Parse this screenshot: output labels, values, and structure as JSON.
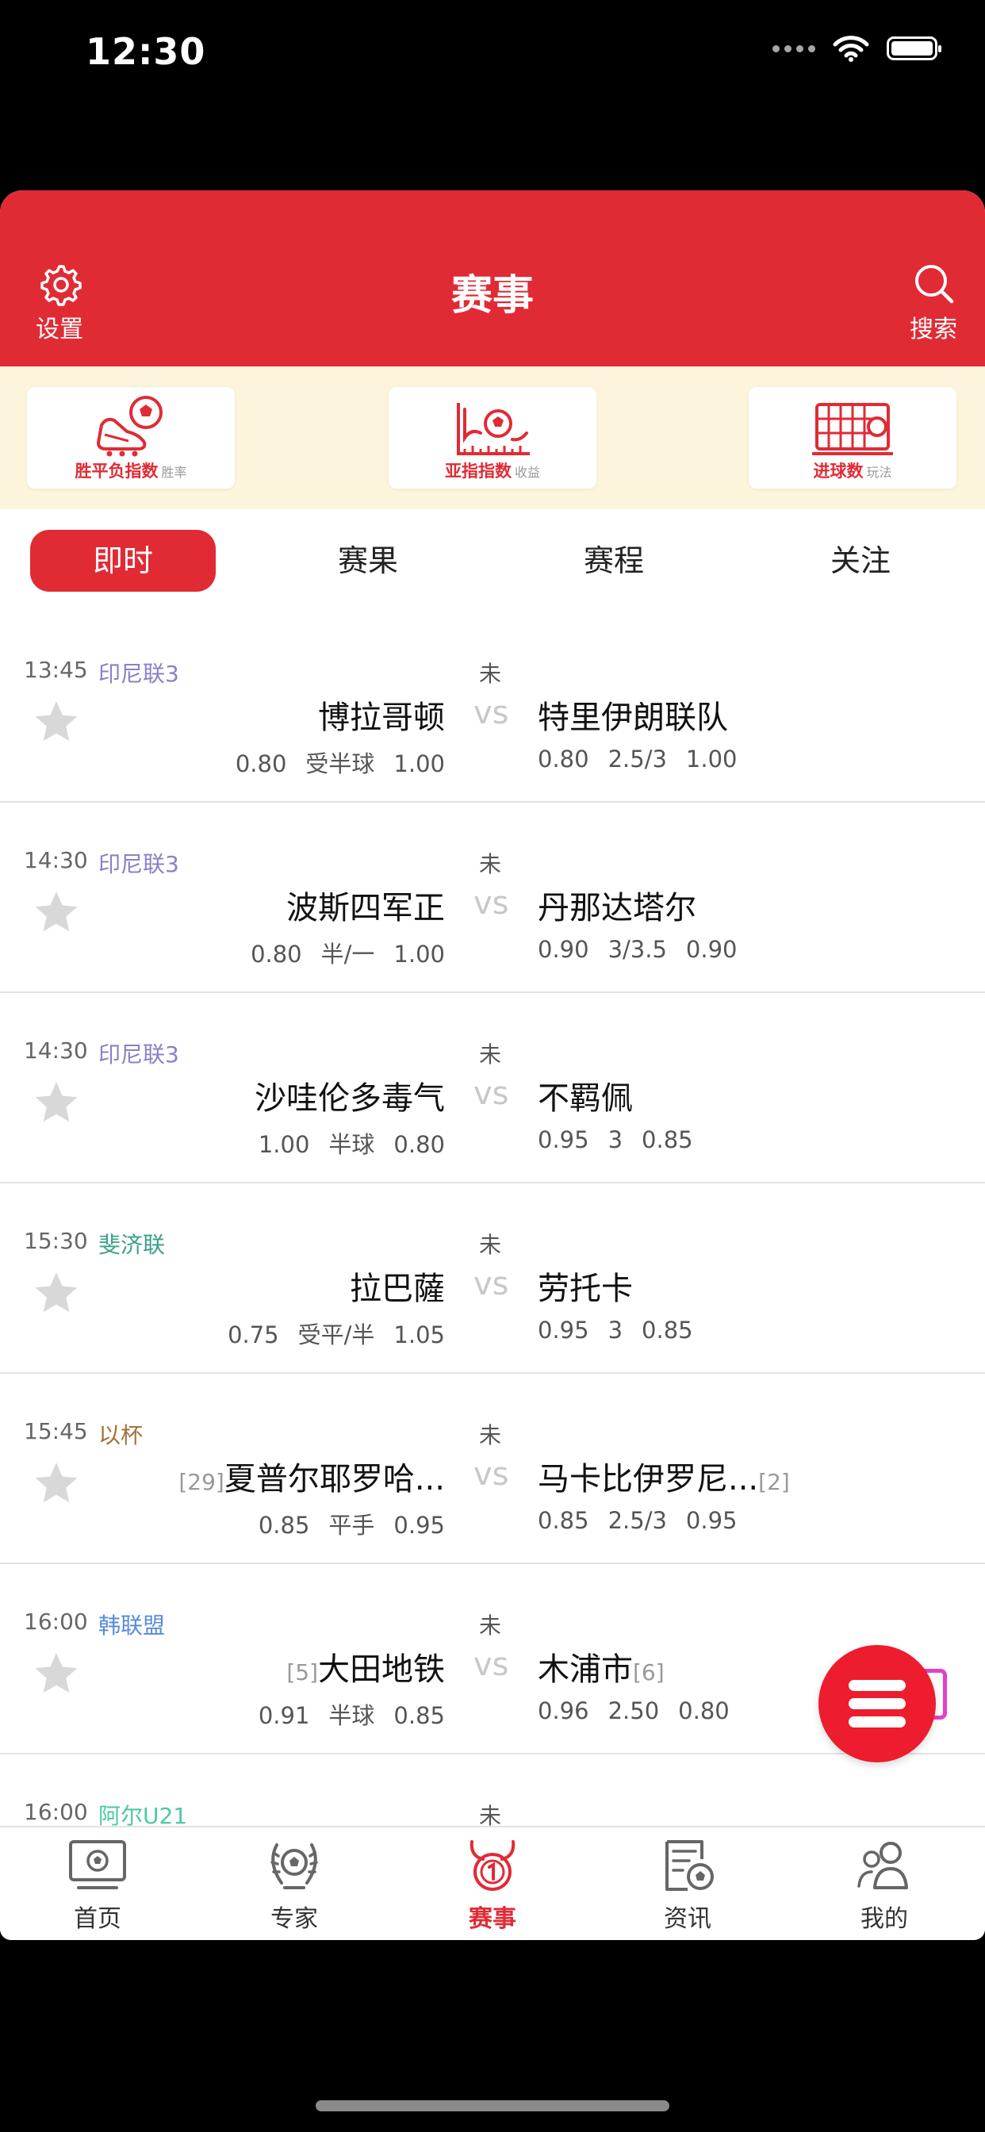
{
  "status_bar": {
    "time": "12:30"
  },
  "header": {
    "title": "赛事",
    "left_label": "设置",
    "right_label": "搜索"
  },
  "promo": [
    {
      "label": "胜平负指数",
      "sub": "胜率"
    },
    {
      "label": "亚指指数",
      "sub": "收益"
    },
    {
      "label": "进球数",
      "sub": "玩法"
    }
  ],
  "tabs": [
    {
      "label": "即时",
      "active": true
    },
    {
      "label": "赛果"
    },
    {
      "label": "赛程"
    },
    {
      "label": "关注"
    }
  ],
  "vs_label": "vs",
  "matches": [
    {
      "time": "13:45",
      "league": "印尼联3",
      "league_color": "#8a80c8",
      "status": "未",
      "home": "博拉哥顿",
      "home_rank": "",
      "away": "特里伊朗联队",
      "away_rank": "",
      "home_odds": [
        "0.80",
        "受半球",
        "1.00"
      ],
      "away_odds": [
        "0.80",
        "2.5/3",
        "1.00"
      ]
    },
    {
      "time": "14:30",
      "league": "印尼联3",
      "league_color": "#8a80c8",
      "status": "未",
      "home": "波斯四军正",
      "home_rank": "",
      "away": "丹那达塔尔",
      "away_rank": "",
      "home_odds": [
        "0.80",
        "半/一",
        "1.00"
      ],
      "away_odds": [
        "0.90",
        "3/3.5",
        "0.90"
      ]
    },
    {
      "time": "14:30",
      "league": "印尼联3",
      "league_color": "#8a80c8",
      "status": "未",
      "home": "沙哇伦多毒气",
      "home_rank": "",
      "away": "不羁佩",
      "away_rank": "",
      "home_odds": [
        "1.00",
        "半球",
        "0.80"
      ],
      "away_odds": [
        "0.95",
        "3",
        "0.85"
      ]
    },
    {
      "time": "15:30",
      "league": "斐济联",
      "league_color": "#3aa08a",
      "status": "未",
      "home": "拉巴薩",
      "home_rank": "",
      "away": "劳托卡",
      "away_rank": "",
      "home_odds": [
        "0.75",
        "受平/半",
        "1.05"
      ],
      "away_odds": [
        "0.95",
        "3",
        "0.85"
      ]
    },
    {
      "time": "15:45",
      "league": "以杯",
      "league_color": "#a0723a",
      "status": "未",
      "home": "夏普尔耶罗哈...",
      "home_rank": "[29]",
      "away": "马卡比伊罗尼...",
      "away_rank": "[2]",
      "home_odds": [
        "0.85",
        "平手",
        "0.95"
      ],
      "away_odds": [
        "0.85",
        "2.5/3",
        "0.95"
      ]
    },
    {
      "time": "16:00",
      "league": "韩联盟",
      "league_color": "#5a8ad6",
      "status": "未",
      "home": "大田地铁",
      "home_rank": "[5]",
      "away": "木浦市",
      "away_rank": "[6]",
      "home_odds": [
        "0.91",
        "半球",
        "0.85"
      ],
      "away_odds": [
        "0.96",
        "2.50",
        "0.80"
      ]
    },
    {
      "time": "16:00",
      "league": "阿尔U21",
      "league_color": "#4cc8a8",
      "status": "未",
      "home": "",
      "home_rank": "",
      "away": "",
      "away_rank": "",
      "home_odds": [
        "",
        "",
        ""
      ],
      "away_odds": [
        "",
        "",
        ""
      ]
    }
  ],
  "tabbar": [
    {
      "label": "首页",
      "icon": "tv-ball-icon"
    },
    {
      "label": "专家",
      "icon": "laurel-ball-icon"
    },
    {
      "label": "赛事",
      "icon": "horned-1-icon",
      "active": true
    },
    {
      "label": "资讯",
      "icon": "news-ball-icon"
    },
    {
      "label": "我的",
      "icon": "people-icon"
    }
  ],
  "colors": {
    "brand_red": "#e02b35",
    "promo_bg": "#fdf4dc",
    "vs_gray": "#c8c8c8"
  }
}
